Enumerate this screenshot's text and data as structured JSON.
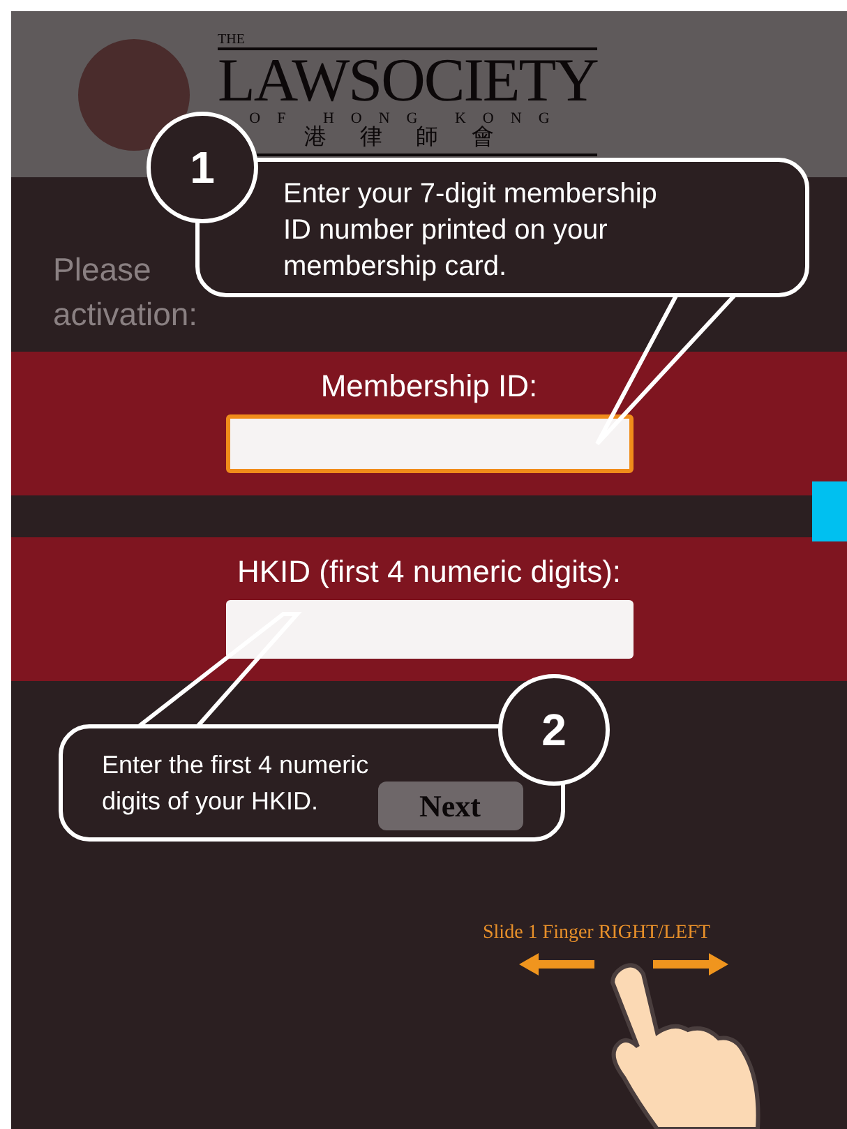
{
  "header": {
    "logo": {
      "top_line": "THE",
      "name": "LAWSOCIETY",
      "subtitle": "OF HONG KONG",
      "chinese_visible": "港 律 師 會"
    }
  },
  "instructions": {
    "line_1_visible": "Please",
    "line_2": "activation:"
  },
  "fields": [
    {
      "label": "Membership ID:",
      "focused": true
    },
    {
      "label": "HKID (first 4 numeric digits):",
      "focused": false
    }
  ],
  "next_button": "Next",
  "tutorial": {
    "callouts": [
      {
        "number": "1",
        "text": "Enter your 7-digit membership ID number printed on your membership card."
      },
      {
        "number": "2",
        "text": "Enter the first 4 numeric digits of your HKID."
      }
    ],
    "gesture_hint": "Slide 1 Finger RIGHT/LEFT"
  }
}
